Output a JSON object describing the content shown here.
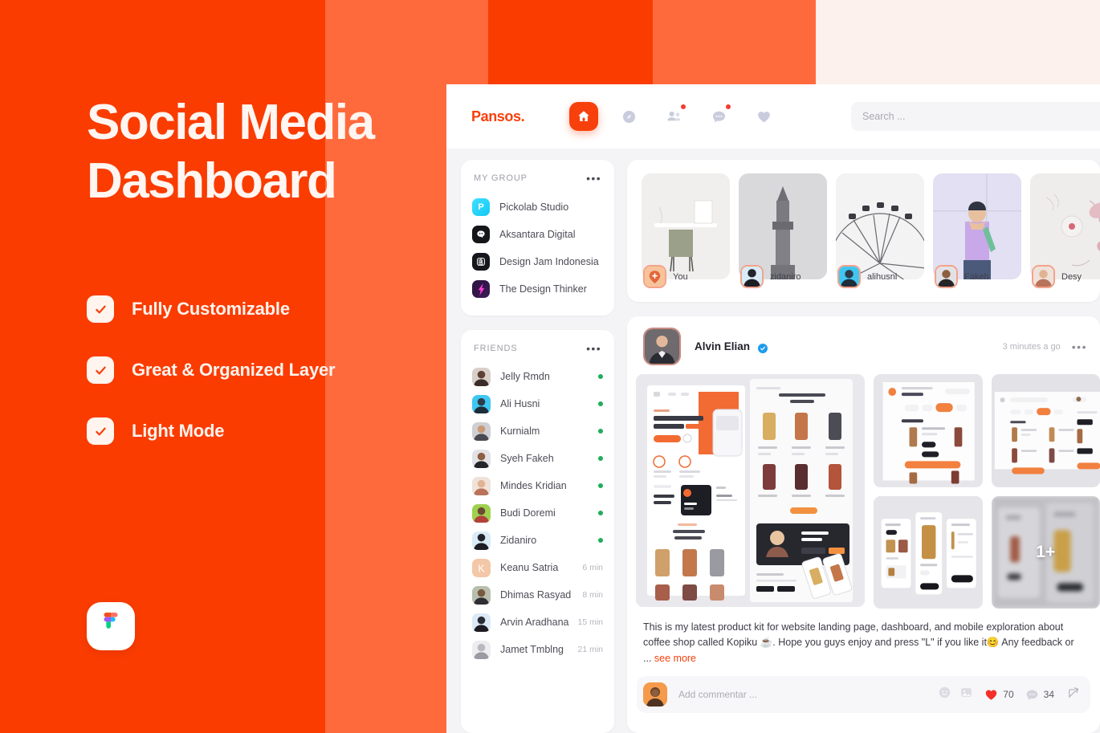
{
  "promo": {
    "headline_line1": "Social Media",
    "headline_line2": "Dashboard",
    "features": [
      {
        "label": "Fully Customizable"
      },
      {
        "label": "Great & Organized Layer"
      },
      {
        "label": "Light Mode"
      }
    ],
    "badge_icon": "figma-logo"
  },
  "app": {
    "brand": "Pansos",
    "brand_dot": ".",
    "nav": [
      {
        "icon": "home-icon",
        "active": true,
        "badge": false
      },
      {
        "icon": "compass-icon",
        "active": false,
        "badge": false
      },
      {
        "icon": "people-icon",
        "active": false,
        "badge": true
      },
      {
        "icon": "chat-icon",
        "active": false,
        "badge": true
      },
      {
        "icon": "heart-icon",
        "active": false,
        "badge": false
      }
    ],
    "search": {
      "placeholder": "Search ...",
      "icon": "search-icon"
    },
    "sidebar": {
      "group_section": {
        "title": "MY GROUP",
        "menu": "•••",
        "items": [
          {
            "name": "Pickolab Studio",
            "icon": "pickolab-logo"
          },
          {
            "name": "Aksantara Digital",
            "icon": "aksantara-logo"
          },
          {
            "name": "Design Jam Indonesia",
            "icon": "designjam-logo"
          },
          {
            "name": "The Design Thinker",
            "icon": "designthinker-logo"
          }
        ]
      },
      "friends_section": {
        "title": "FRIENDS",
        "menu": "•••",
        "items": [
          {
            "name": "Jelly Rmdn",
            "online": true,
            "time": ""
          },
          {
            "name": "Ali Husni",
            "online": true,
            "time": ""
          },
          {
            "name": "Kurnialm",
            "online": true,
            "time": ""
          },
          {
            "name": "Syeh Fakeh",
            "online": true,
            "time": ""
          },
          {
            "name": "Mindes Kridian",
            "online": true,
            "time": ""
          },
          {
            "name": "Budi Doremi",
            "online": true,
            "time": ""
          },
          {
            "name": "Zidaniro",
            "online": true,
            "time": ""
          },
          {
            "name": "Keanu Satria",
            "online": false,
            "time": "6 min"
          },
          {
            "name": "Dhimas Rasyad",
            "online": false,
            "time": "8 min"
          },
          {
            "name": "Arvin Aradhana",
            "online": false,
            "time": "15 min"
          },
          {
            "name": "Jamet Tmblng",
            "online": false,
            "time": "21 min"
          }
        ]
      }
    },
    "stories": [
      {
        "name": "You",
        "add": true
      },
      {
        "name": "zidaniro",
        "add": false
      },
      {
        "name": "alihusni",
        "add": false
      },
      {
        "name": "Fakeh",
        "add": false
      },
      {
        "name": "Desy",
        "add": false
      }
    ],
    "post": {
      "author": "Alvin Elian",
      "verified": true,
      "time": "3 minutes a go",
      "menu": "•••",
      "caption": "This is my latest product kit for website landing page, dashboard, and mobile exploration about coffee shop called Kopiku ☕. Hope you guys enjoy and press \"L\" if you like it😊 Any feedback or ... ",
      "see_more": "see more",
      "gallery_more_badge": "1+",
      "comment": {
        "placeholder": "Add commentar ...",
        "emoji_icon": "emoji-icon",
        "image_icon": "image-icon",
        "like_icon": "heart-icon",
        "likes": "70",
        "comment_icon": "comment-icon",
        "comments": "34",
        "share_icon": "share-icon"
      }
    }
  },
  "colors": {
    "accent": "#F7400B",
    "promo_bg": "#FA3C00",
    "promo_band": "#FF6A3D",
    "promo_band_light": "#FCF1EC",
    "online": "#1FAE5A",
    "verified": "#1D9BF0"
  }
}
